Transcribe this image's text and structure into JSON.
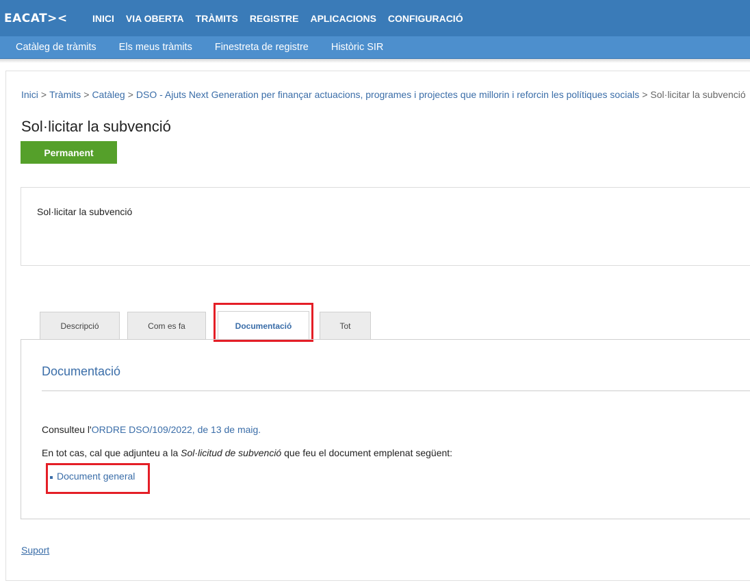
{
  "header": {
    "logo_text": "EACAT><",
    "nav": [
      "INICI",
      "VIA OBERTA",
      "TRÀMITS",
      "REGISTRE",
      "APLICACIONS",
      "CONFIGURACIÓ"
    ],
    "subnav": [
      "Catàleg de tràmits",
      "Els meus tràmits",
      "Finestreta de registre",
      "Històric SIR"
    ]
  },
  "breadcrumb": {
    "items": [
      "Inici",
      "Tràmits",
      "Catàleg",
      "DSO - Ajuts Next Generation per finançar actuacions, programes i projectes que millorin i reforcin les polítiques socials"
    ],
    "current": "Sol·licitar la subvenció"
  },
  "page": {
    "title": "Sol·licitar la subvenció",
    "badge": "Permanent",
    "description": "Sol·licitar la subvenció"
  },
  "tabs": [
    {
      "label": "Descripció",
      "active": false
    },
    {
      "label": "Com es fa",
      "active": false
    },
    {
      "label": "Documentació",
      "active": true
    },
    {
      "label": "Tot",
      "active": false
    }
  ],
  "panel": {
    "title": "Documentació",
    "consult_prefix": "Consulteu l'",
    "consult_link": "ORDRE DSO/109/2022, de 13 de maig.",
    "attach_prefix": "En tot cas, cal que adjunteu a la ",
    "attach_emphasis": "Sol·licitud de subvenció",
    "attach_suffix": " que feu el document emplenat següent:",
    "document_link": "Document general"
  },
  "footer": {
    "support": "Suport"
  },
  "colors": {
    "topbar": "#3a7bb8",
    "subbar": "#4d8fcd",
    "link": "#3a6da8",
    "badge": "#55a02a",
    "highlight": "#e41e26"
  }
}
